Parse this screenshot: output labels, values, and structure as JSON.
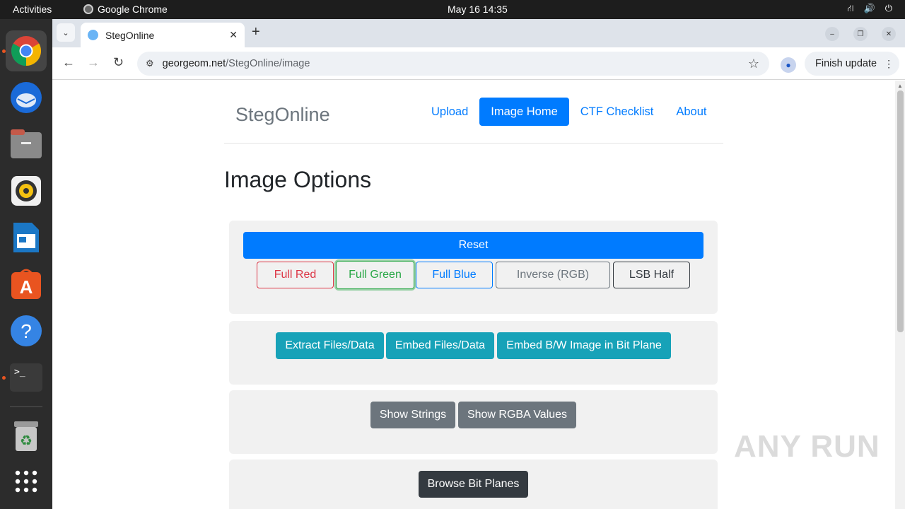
{
  "system": {
    "activities": "Activities",
    "app_name": "Google Chrome",
    "clock": "May 16  14:35"
  },
  "browser": {
    "tab_title": "StegOnline",
    "url_host": "georgeom.net",
    "url_path": "/StegOnline/image",
    "finish_update": "Finish update"
  },
  "site": {
    "brand": "StegOnline",
    "nav": [
      {
        "label": "Upload",
        "active": false
      },
      {
        "label": "Image Home",
        "active": true
      },
      {
        "label": "CTF Checklist",
        "active": false
      },
      {
        "label": "About",
        "active": false
      }
    ],
    "heading": "Image Options",
    "reset": "Reset",
    "color_buttons": [
      {
        "label": "Full Red",
        "color": "#dc3545"
      },
      {
        "label": "Full Green",
        "color": "#28a745"
      },
      {
        "label": "Full Blue",
        "color": "#007bff"
      },
      {
        "label": "Inverse (RGB)",
        "color": "#6c757d"
      },
      {
        "label": "LSB Half",
        "color": "#343a40"
      }
    ],
    "data_buttons": [
      "Extract Files/Data",
      "Embed Files/Data",
      "Embed B/W Image in Bit Plane"
    ],
    "string_buttons": [
      "Show Strings",
      "Show RGBA Values"
    ],
    "browse_button": "Browse Bit Planes"
  },
  "watermark": "ANY RUN"
}
